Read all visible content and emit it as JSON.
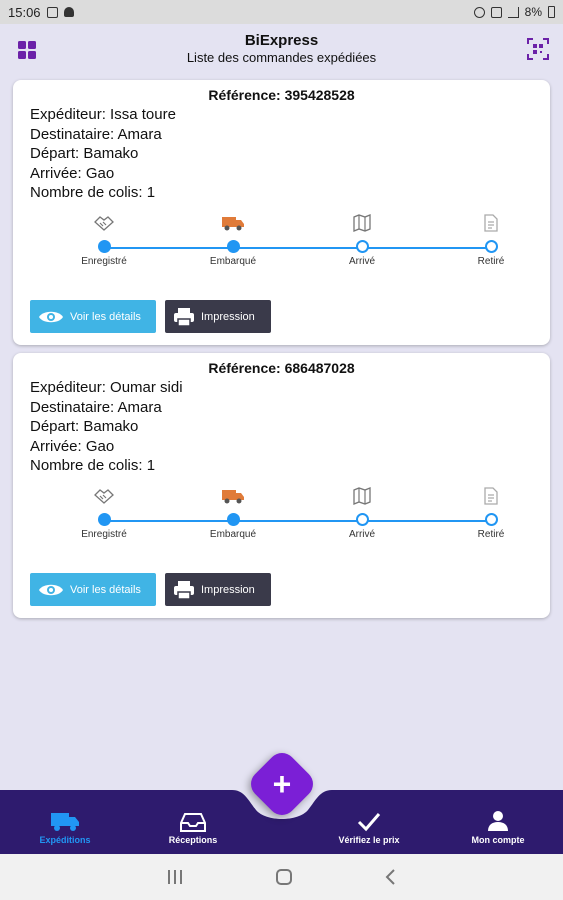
{
  "status_bar": {
    "time": "15:06",
    "battery": "8%"
  },
  "header": {
    "title": "BiExpress",
    "subtitle": "Liste des commandes expédiées"
  },
  "colors": {
    "accent": "#2196f3",
    "primary": "#6b21a8",
    "nav_bg": "#2e1b6e",
    "fab": "#7b1fd6",
    "details_btn": "#40b4e5",
    "print_btn": "#3a3a4a"
  },
  "steps": [
    "Enregistré",
    "Embarqué",
    "Arrivé",
    "Retiré"
  ],
  "orders": [
    {
      "reference": "Référence: 395428528",
      "sender": "Expéditeur: Issa toure",
      "recipient": "Destinataire: Amara",
      "departure": "Départ: Bamako",
      "arrival": "Arrivée: Gao",
      "parcels": "Nombre de colis: 1",
      "completed_steps": 2,
      "details_label": "Voir les détails",
      "print_label": "Impression"
    },
    {
      "reference": "Référence: 686487028",
      "sender": "Expéditeur: Oumar sidi",
      "recipient": "Destinataire: Amara",
      "departure": "Départ: Bamako",
      "arrival": "Arrivée: Gao",
      "parcels": "Nombre de colis: 1",
      "completed_steps": 2,
      "details_label": "Voir les détails",
      "print_label": "Impression"
    }
  ],
  "bottom_nav": [
    {
      "label": "Expéditions",
      "icon": "truck-icon",
      "active": true
    },
    {
      "label": "Réceptions",
      "icon": "inbox-icon",
      "active": false
    },
    {
      "label": "Vérifiez le prix",
      "icon": "check-icon",
      "active": false
    },
    {
      "label": "Mon compte",
      "icon": "user-icon",
      "active": false
    }
  ],
  "fab": {
    "label": "+"
  }
}
